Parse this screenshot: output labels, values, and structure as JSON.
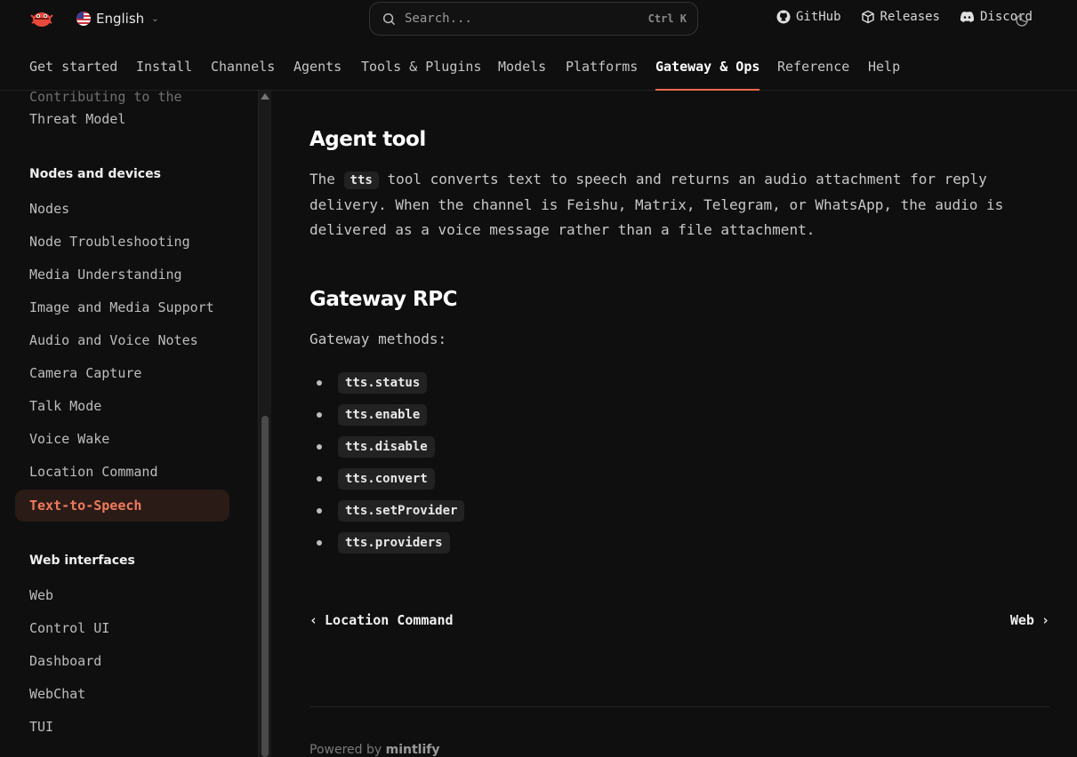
{
  "header": {
    "logo_icon": "lobster-logo-icon",
    "language": "English",
    "search": {
      "placeholder": "Search...",
      "shortcut": "Ctrl K"
    },
    "links": [
      {
        "label": "GitHub",
        "icon": "github-icon"
      },
      {
        "label": "Releases",
        "icon": "package-icon"
      },
      {
        "label": "Discord",
        "icon": "discord-icon"
      }
    ],
    "theme_icon": "moon-icon"
  },
  "nav": {
    "tabs": [
      {
        "label": "Get started"
      },
      {
        "label": "Install"
      },
      {
        "label": "Channels"
      },
      {
        "label": "Agents"
      },
      {
        "label": "Tools & Plugins"
      },
      {
        "label": "Models"
      },
      {
        "label": "Platforms"
      },
      {
        "label": "Gateway & Ops",
        "active": true
      },
      {
        "label": "Reference"
      },
      {
        "label": "Help"
      }
    ]
  },
  "sidebar": {
    "prev_items": [
      "Contributing to the",
      "Threat Model"
    ],
    "group_nodes": {
      "title": "Nodes and devices",
      "items": [
        "Nodes",
        "Node Troubleshooting",
        "Media Understanding",
        "Image and Media Support",
        "Audio and Voice Notes",
        "Camera Capture",
        "Talk Mode",
        "Voice Wake",
        "Location Command",
        "Text-to-Speech"
      ],
      "active": "Text-to-Speech"
    },
    "group_web": {
      "title": "Web interfaces",
      "items": [
        "Web",
        "Control UI",
        "Dashboard",
        "WebChat",
        "TUI"
      ]
    }
  },
  "content": {
    "agent_tool": {
      "heading": "Agent tool",
      "p_before": "The ",
      "code": "tts",
      "p_line1_after": " tool converts text to speech and returns an audio attachment for reply",
      "p_line2": "delivery. When the channel is Feishu, Matrix, Telegram, or WhatsApp, the audio is",
      "p_line3": "delivered as a voice message rather than a file attachment."
    },
    "gateway_rpc": {
      "heading": "Gateway RPC",
      "intro": "Gateway methods:",
      "methods": [
        "tts.status",
        "tts.enable",
        "tts.disable",
        "tts.convert",
        "tts.setProvider",
        "tts.providers"
      ]
    },
    "pager": {
      "prev": "Location Command",
      "next": "Web"
    },
    "footer": {
      "powered_prefix": "Powered by",
      "powered_brand": "mintlify"
    }
  },
  "colors": {
    "background": "#0f0f0f",
    "accent": "#f06a4f",
    "active_bg": "#2a1b17"
  }
}
